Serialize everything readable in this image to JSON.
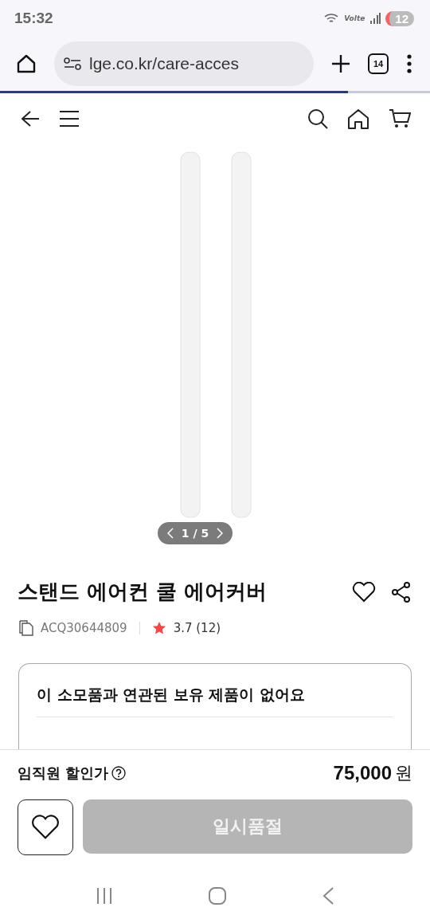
{
  "status_bar": {
    "time": "15:32",
    "network": "Volte",
    "battery": "12"
  },
  "browser": {
    "url": "lge.co.kr/care-acces",
    "tab_count": "14",
    "load_progress": {
      "level": 0.81
    }
  },
  "gallery": {
    "counter": "1 / 5"
  },
  "product": {
    "title": "스탠드 에어컨 쿨 에어커버",
    "model": "ACQ30644809",
    "rating": "3.7",
    "review_count": "(12)"
  },
  "owned_card": {
    "title": "이 소모품과 연관된 보유 제품이 없어요"
  },
  "purchase": {
    "price_label": "임직원 할인가",
    "price": "75,000",
    "currency": "원",
    "buy_button": {
      "label": "일시품절",
      "disabled": true
    }
  }
}
